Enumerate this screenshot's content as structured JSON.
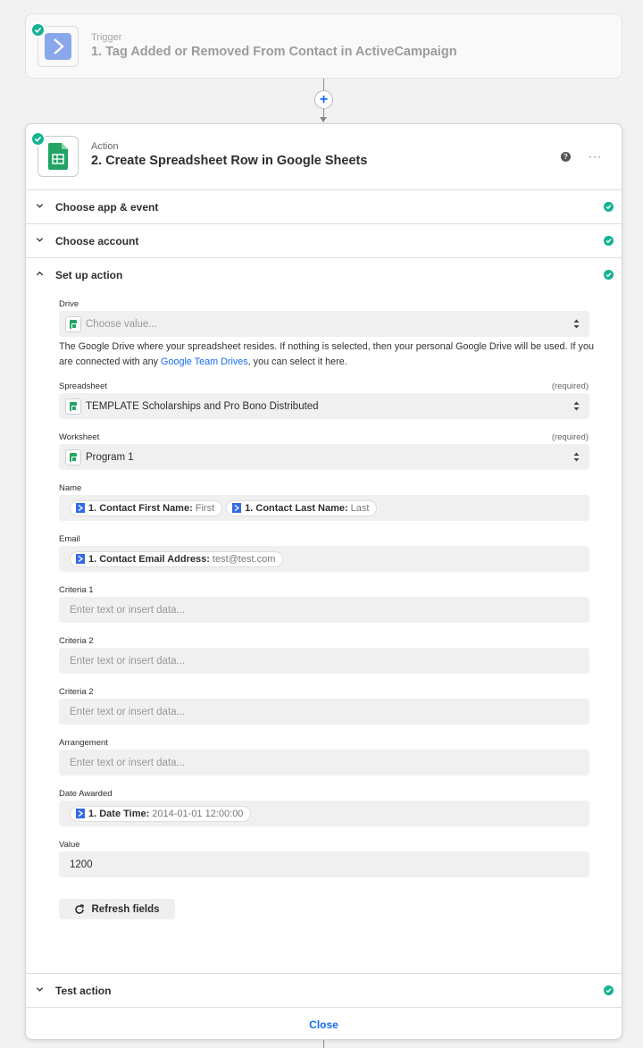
{
  "trigger": {
    "subtitle": "Trigger",
    "title": "1. Tag Added or Removed From Contact in ActiveCampaign"
  },
  "action": {
    "subtitle": "Action",
    "title": "2. Create Spreadsheet Row in Google Sheets",
    "help_icon": "?",
    "more_icon": "···"
  },
  "sections": {
    "choose_app": "Choose app & event",
    "choose_account": "Choose account",
    "setup": "Set up action",
    "test": "Test action"
  },
  "fields": {
    "drive": {
      "label": "Drive",
      "placeholder": "Choose value...",
      "help_before": "The Google Drive where your spreadsheet resides. If nothing is selected, then your personal Google Drive will be used. If you are connected with any ",
      "help_link": "Google Team Drives",
      "help_after": ", you can select it here."
    },
    "spreadsheet": {
      "label": "Spreadsheet",
      "required": "(required)",
      "value": "TEMPLATE Scholarships and Pro Bono Distributed"
    },
    "worksheet": {
      "label": "Worksheet",
      "required": "(required)",
      "value": "Program 1"
    },
    "name": {
      "label": "Name",
      "pills": [
        {
          "key": "1. Contact First Name:",
          "value": "First"
        },
        {
          "key": "1. Contact Last Name:",
          "value": "Last"
        }
      ]
    },
    "email": {
      "label": "Email",
      "pills": [
        {
          "key": "1. Contact Email Address:",
          "value": "test@test.com"
        }
      ]
    },
    "criteria1": {
      "label": "Criteria 1",
      "placeholder": "Enter text or insert data..."
    },
    "criteria2a": {
      "label": "Criteria 2",
      "placeholder": "Enter text or insert data..."
    },
    "criteria2b": {
      "label": "Criteria 2",
      "placeholder": "Enter text or insert data..."
    },
    "arrangement": {
      "label": "Arrangement",
      "placeholder": "Enter text or insert data..."
    },
    "date_awarded": {
      "label": "Date Awarded",
      "pills": [
        {
          "key": "1. Date Time:",
          "value": "2014-01-01 12:00:00"
        }
      ]
    },
    "value": {
      "label": "Value",
      "value": "1200"
    }
  },
  "buttons": {
    "refresh": "Refresh fields",
    "close": "Close"
  },
  "colors": {
    "accent": "#136bf5",
    "success": "#13b293",
    "sheets_green": "#21a464",
    "activecampaign_blue": "#356ae6"
  }
}
